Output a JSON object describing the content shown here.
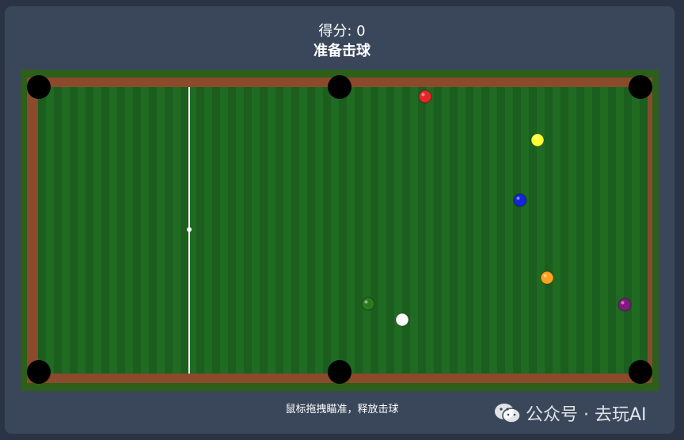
{
  "header": {
    "score_text": "得分: 0",
    "status_text": "准备击球"
  },
  "footer": {
    "hint_text": "鼠标拖拽瞄准，释放击球",
    "watermark_text": "公众号 · 去玩AI"
  },
  "colors": {
    "background": "#2b3445",
    "panel": "#3a475b",
    "rail_wood": "#8b4a2b",
    "felt": "#1f6b22",
    "felt_stripe": "#1b5e1e",
    "pocket": "#000000",
    "aim_line": "#ffffff"
  },
  "balls": [
    {
      "name": "red-ball",
      "color": "#e3262a"
    },
    {
      "name": "yellow-ball",
      "color": "#ffff33"
    },
    {
      "name": "blue-ball",
      "color": "#1226d8"
    },
    {
      "name": "orange-ball",
      "color": "#ffa21f"
    },
    {
      "name": "green-ball",
      "color": "#2b7a1f"
    },
    {
      "name": "purple-ball",
      "color": "#801a80"
    },
    {
      "name": "cue-ball",
      "color": "#ffffff"
    }
  ],
  "icons": {
    "watermark": "wechat-icon"
  }
}
